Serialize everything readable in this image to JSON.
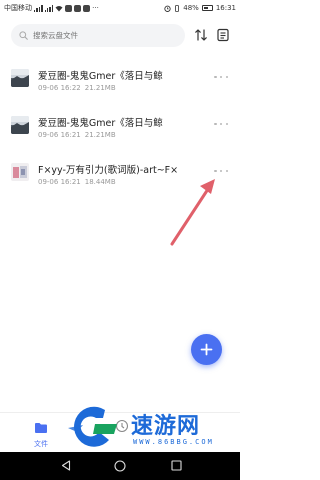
{
  "status_bar": {
    "carrier": "中国移动",
    "battery": "48%",
    "time": "16:31"
  },
  "search": {
    "placeholder": "搜索云盘文件"
  },
  "files": [
    {
      "name": "爱豆圈-鬼鬼Gmer《落日与鲸",
      "date": "09-06 16:22",
      "size": "21.21MB"
    },
    {
      "name": "爱豆圈-鬼鬼Gmer《落日与鲸",
      "date": "09-06 16:21",
      "size": "21.21MB"
    },
    {
      "name": "F×yy-万有引力(歌词版)-art~F×",
      "date": "09-06 16:21",
      "size": "18.44MB"
    }
  ],
  "bottom_nav": {
    "files_label": "文件"
  },
  "watermark": {
    "title": "速游网",
    "url": "WWW.86BBG.COM"
  },
  "colors": {
    "accent": "#4a70f1",
    "arrow": "#e0606a",
    "watermark": "#1d6ad8"
  },
  "icons": {
    "search": "search-icon",
    "sort": "sort-icon",
    "list": "list-icon",
    "more": "more-icon",
    "add": "plus-icon",
    "folder": "folder-icon"
  }
}
